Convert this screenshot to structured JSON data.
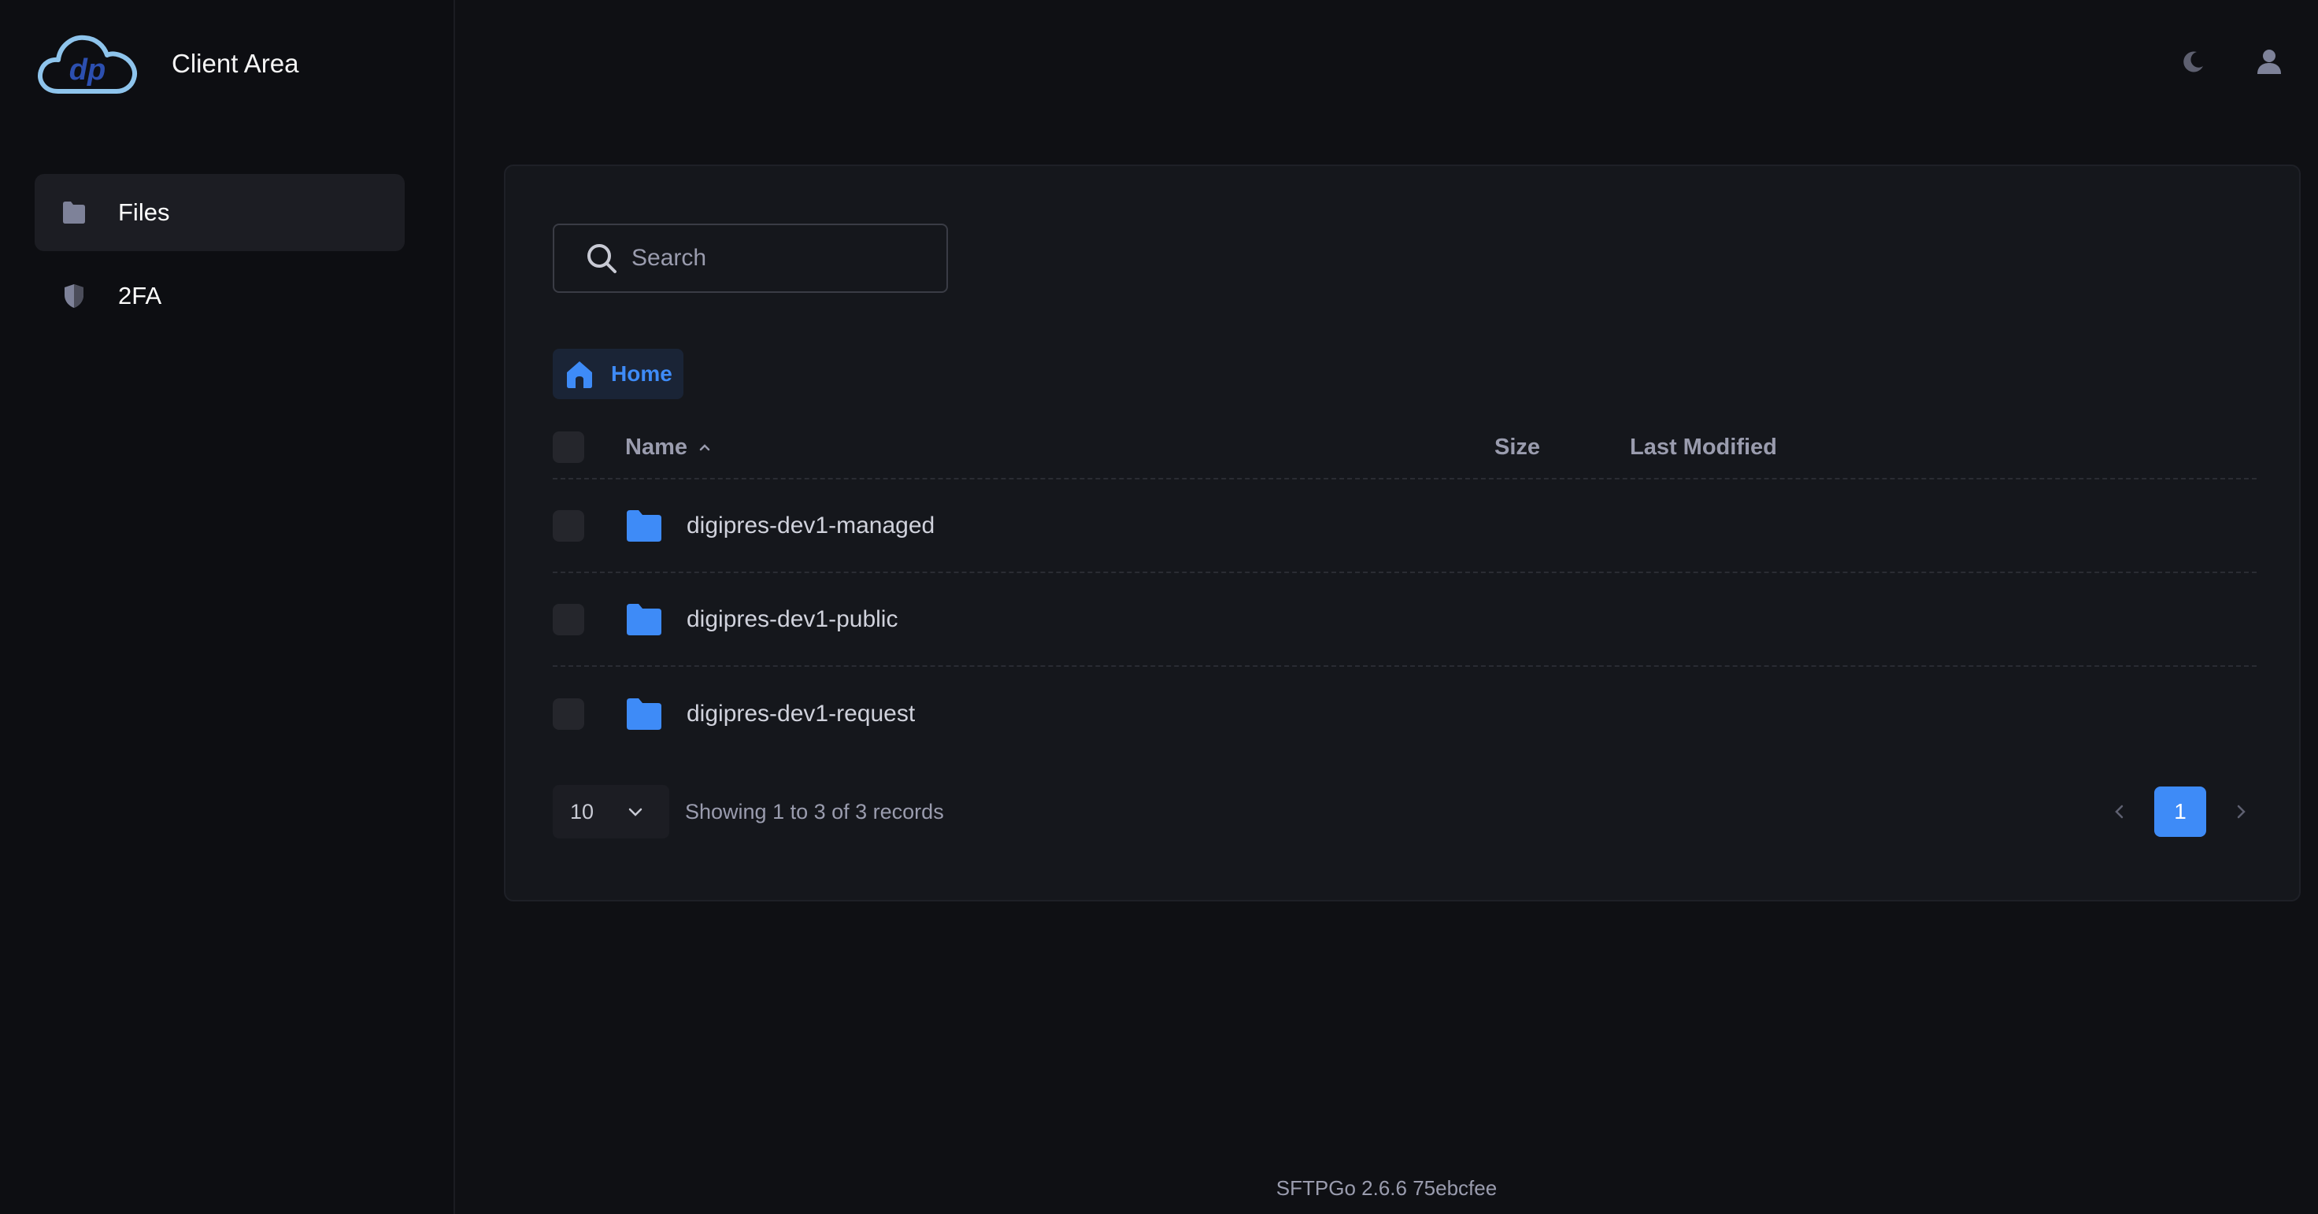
{
  "app": {
    "title": "Client Area",
    "version": "SFTPGo 2.6.6 75ebcfee"
  },
  "sidebar": {
    "items": [
      {
        "label": "Files",
        "icon": "folder-icon",
        "active": true
      },
      {
        "label": "2FA",
        "icon": "shield-icon",
        "active": false
      }
    ]
  },
  "header": {
    "theme_icon": "moon-icon",
    "user_icon": "user-icon"
  },
  "search": {
    "placeholder": "Search",
    "value": ""
  },
  "breadcrumb": {
    "home_label": "Home"
  },
  "table": {
    "columns": {
      "name": "Name",
      "size": "Size",
      "modified": "Last Modified"
    },
    "sort": {
      "column": "Name",
      "direction": "asc"
    },
    "rows": [
      {
        "name": "digipres-dev1-managed",
        "type": "folder",
        "size": "",
        "modified": ""
      },
      {
        "name": "digipres-dev1-public",
        "type": "folder",
        "size": "",
        "modified": ""
      },
      {
        "name": "digipres-dev1-request",
        "type": "folder",
        "size": "",
        "modified": ""
      }
    ]
  },
  "pagination": {
    "page_size": "10",
    "info": "Showing 1 to 3 of 3 records",
    "current_page": "1"
  },
  "colors": {
    "accent": "#3e8bf7",
    "background": "#0f1014",
    "card": "#15171c"
  }
}
